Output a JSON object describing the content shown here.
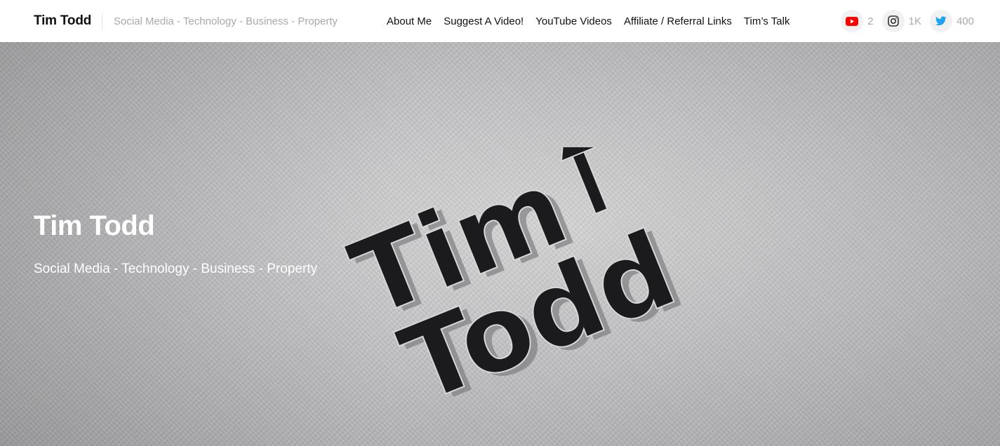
{
  "header": {
    "brand": "Tim Todd",
    "tagline": "Social Media - Technology - Business - Property",
    "nav": [
      {
        "label": "About Me"
      },
      {
        "label": "Suggest A Video!"
      },
      {
        "label": "YouTube Videos"
      },
      {
        "label": "Affiliate / Referral Links"
      },
      {
        "label": "Tim’s Talk"
      }
    ],
    "social": [
      {
        "icon": "youtube-icon",
        "count": "2",
        "color": "#ff0000"
      },
      {
        "icon": "instagram-icon",
        "count": "1K",
        "color": "#333333"
      },
      {
        "icon": "twitter-icon",
        "count": "400",
        "color": "#1da1f2"
      }
    ]
  },
  "hero": {
    "title": "Tim Todd",
    "subtitle": "Social Media - Technology - Business - Property",
    "logo": {
      "text_top": "Tim",
      "text_bottom": "Todd"
    }
  }
}
